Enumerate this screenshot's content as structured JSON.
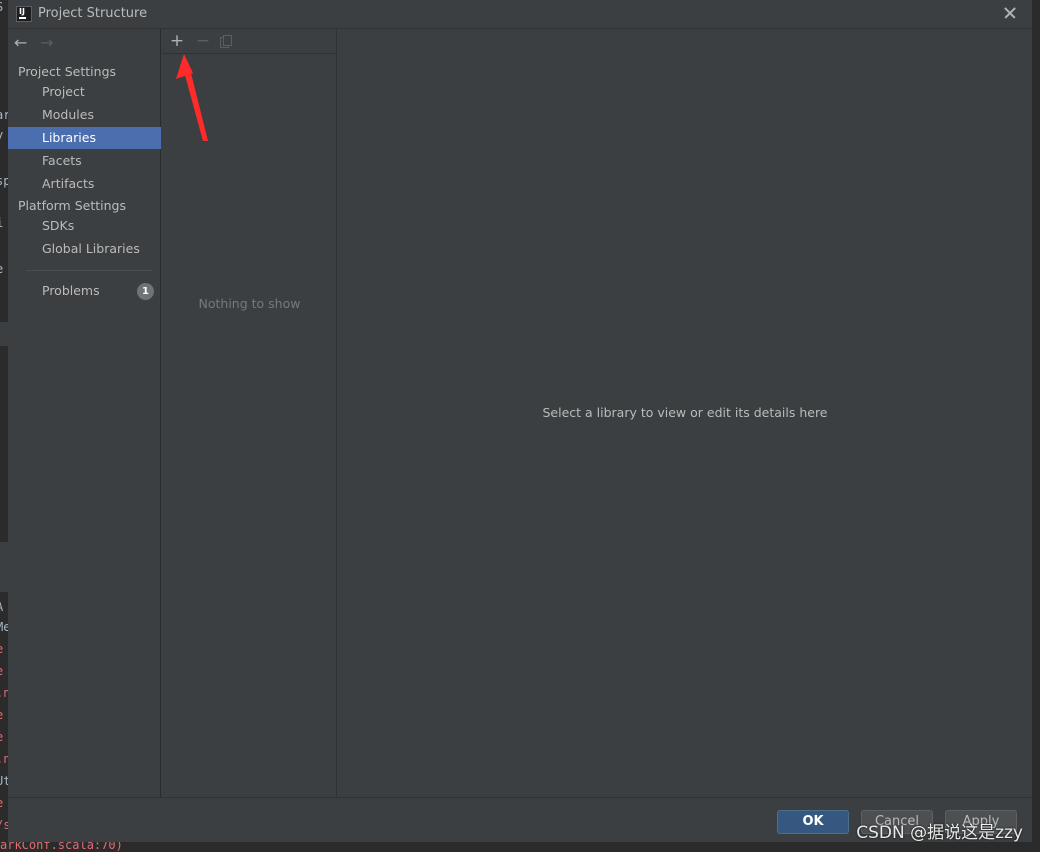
{
  "window": {
    "title": "Project Structure",
    "icon": "intellij-icon"
  },
  "navigation": {
    "back": "back-arrow-icon",
    "forward": "forward-arrow-icon"
  },
  "sidebar": {
    "project_settings_header": "Project Settings",
    "project_items": [
      {
        "label": "Project"
      },
      {
        "label": "Modules"
      },
      {
        "label": "Libraries",
        "selected": true
      },
      {
        "label": "Facets"
      },
      {
        "label": "Artifacts"
      }
    ],
    "platform_settings_header": "Platform Settings",
    "platform_items": [
      {
        "label": "SDKs"
      },
      {
        "label": "Global Libraries"
      }
    ],
    "problems": {
      "label": "Problems",
      "count": "1"
    }
  },
  "list_panel": {
    "toolbar": {
      "add": "plus-icon",
      "remove": "minus-icon",
      "copy": "copy-icon"
    },
    "empty_text": "Nothing to show"
  },
  "detail_panel": {
    "placeholder": "Select a library to view or edit its details here"
  },
  "footer": {
    "ok": "OK",
    "cancel": "Cancel",
    "apply": "Apply"
  },
  "watermark": "CSDN @据说这是zzy",
  "background_code": "arkConf.scala:70)",
  "colors": {
    "selection": "#4b6eaf",
    "ok_button": "#365880",
    "annotation_arrow": "#ff2a2a"
  }
}
